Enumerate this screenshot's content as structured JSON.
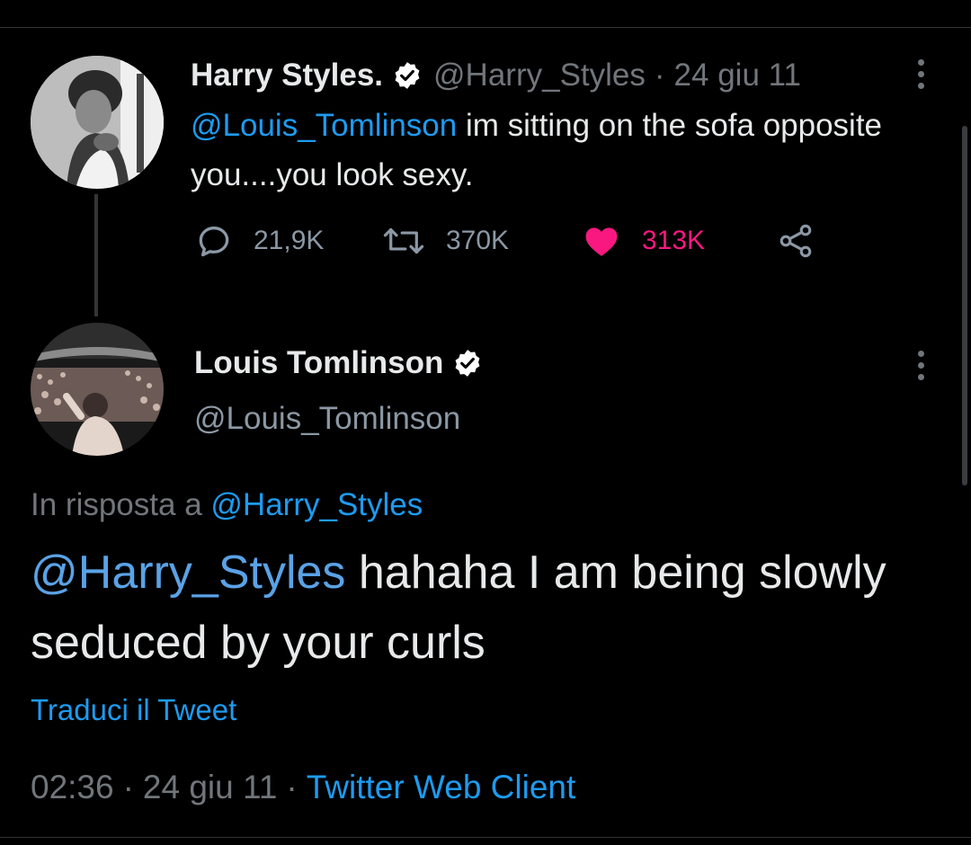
{
  "colors": {
    "background": "#000000",
    "text": "#e7e9ea",
    "muted": "#71767b",
    "link": "#1d9bf0",
    "like": "#f91880",
    "verified_badge": "#ffffff"
  },
  "tweet_parent": {
    "display_name": "Harry Styles.",
    "handle": "@Harry_Styles",
    "separator": "·",
    "date": "24 giu 11",
    "verified": true,
    "avatar_icon": "avatar-photo",
    "mention": "@Louis_Tomlinson",
    "text": " im sitting on the sofa opposite you....you look sexy.",
    "reply_count": "21,9K",
    "retweet_count": "370K",
    "like_count": "313K",
    "liked": true
  },
  "tweet_main": {
    "display_name": "Louis Tomlinson",
    "handle": "@Louis_Tomlinson",
    "verified": true,
    "avatar_icon": "avatar-photo",
    "reply_prefix": "In risposta a ",
    "reply_to_handle": "@Harry_Styles",
    "mention": "@Harry_Styles",
    "text": " hahaha I am being slowly seduced by your curls",
    "translate_label": "Traduci il Tweet",
    "time": "02:36",
    "separator": "·",
    "date": "24 giu 11",
    "client": "Twitter Web Client"
  }
}
